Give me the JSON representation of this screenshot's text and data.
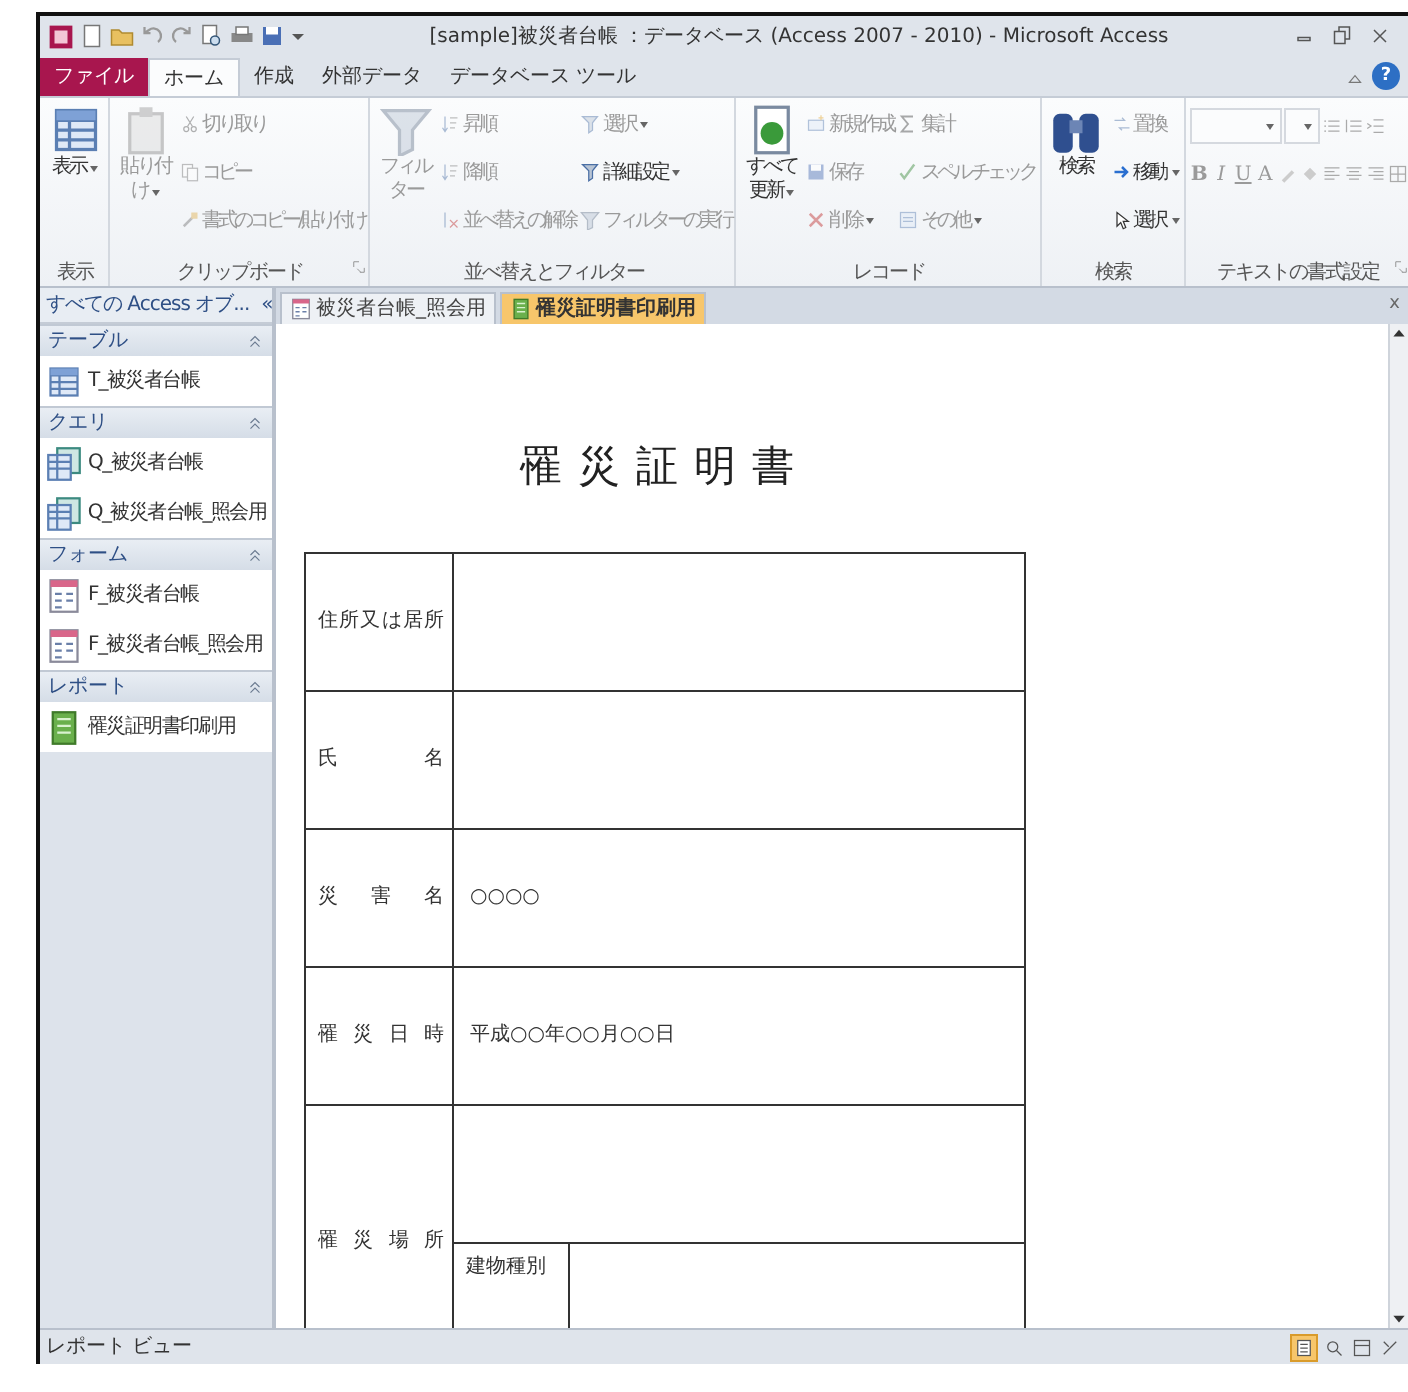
{
  "window": {
    "title": "[sample]被災者台帳 ：データベース (Access 2007 - 2010) - Microsoft Access"
  },
  "ribbon_tabs": [
    {
      "label": "ファイル",
      "kind": "file",
      "selected": false
    },
    {
      "label": "ホーム",
      "kind": "tab",
      "selected": true
    },
    {
      "label": "作成",
      "kind": "tab",
      "selected": false
    },
    {
      "label": "外部データ",
      "kind": "tab",
      "selected": false
    },
    {
      "label": "データベース ツール",
      "kind": "tab",
      "selected": false
    }
  ],
  "help": "?",
  "ribbon_groups": [
    {
      "label": "表示",
      "kind": "buttons",
      "launcher": false,
      "large": {
        "label": "表示",
        "kind": "view",
        "dropdown": true,
        "disabled": false
      }
    },
    {
      "label": "クリップボード",
      "kind": "buttons",
      "launcher": true,
      "large": {
        "label": "貼り付け",
        "kind": "paste",
        "dropdown": true,
        "disabled": true
      },
      "small_columns": [
        [
          {
            "label": "切り取り",
            "kind": "cut",
            "dropdown": false,
            "disabled": true
          },
          {
            "label": "コピー",
            "kind": "copy",
            "dropdown": false,
            "disabled": true
          },
          {
            "label": "書式のコピー/貼り付け",
            "kind": "brush",
            "dropdown": false,
            "disabled": true
          }
        ]
      ]
    },
    {
      "label": "並べ替えとフィルター",
      "kind": "buttons",
      "launcher": false,
      "large": {
        "label": "フィルター",
        "kind": "filter",
        "dropdown": false,
        "disabled": true
      },
      "small_columns": [
        [
          {
            "label": "昇順",
            "kind": "asc",
            "dropdown": false,
            "disabled": true
          },
          {
            "label": "降順",
            "kind": "desc",
            "dropdown": false,
            "disabled": true
          },
          {
            "label": "並べ替えの解除",
            "kind": "clearsort",
            "dropdown": false,
            "disabled": true
          }
        ],
        [
          {
            "label": "選択",
            "kind": "select",
            "dropdown": true,
            "disabled": true
          },
          {
            "label": "詳細設定",
            "kind": "advanced",
            "dropdown": true,
            "disabled": false
          },
          {
            "label": "フィルターの実行",
            "kind": "toggle",
            "dropdown": false,
            "disabled": true
          }
        ]
      ]
    },
    {
      "label": "レコード",
      "kind": "buttons",
      "launcher": false,
      "large": {
        "label": "すべて更新",
        "kind": "refresh",
        "dropdown": true,
        "disabled": false
      },
      "small_columns": [
        [
          {
            "label": "新規作成",
            "kind": "new",
            "dropdown": false,
            "disabled": true
          },
          {
            "label": "保存",
            "kind": "save",
            "dropdown": false,
            "disabled": true
          },
          {
            "label": "削除",
            "kind": "delete",
            "dropdown": true,
            "disabled": true
          }
        ],
        [
          {
            "label": "集計",
            "kind": "sum",
            "dropdown": false,
            "disabled": true
          },
          {
            "label": "スペル チェック",
            "kind": "spell",
            "dropdown": false,
            "disabled": true
          },
          {
            "label": "その他",
            "kind": "more",
            "dropdown": true,
            "disabled": true
          }
        ]
      ]
    },
    {
      "label": "検索",
      "kind": "buttons",
      "launcher": false,
      "large": {
        "label": "検索",
        "kind": "find",
        "dropdown": false,
        "disabled": false
      },
      "small_columns": [
        [
          {
            "label": "置換",
            "kind": "replace",
            "dropdown": false,
            "disabled": true
          },
          {
            "label": "移動",
            "kind": "goto",
            "dropdown": true,
            "disabled": false
          },
          {
            "label": "選択",
            "kind": "pointer",
            "dropdown": true,
            "disabled": false
          }
        ]
      ]
    },
    {
      "label": "テキストの書式設定",
      "kind": "text_format",
      "launcher": true,
      "letters": [
        "B",
        "I",
        "U",
        "A"
      ]
    }
  ],
  "nav": {
    "header": "すべての Access オブ...",
    "collapse": "«",
    "sections": [
      {
        "label": "テーブル",
        "expanded": true,
        "items": [
          {
            "label": "T_被災者台帳",
            "kind": "table"
          }
        ]
      },
      {
        "label": "クエリ",
        "expanded": true,
        "items": [
          {
            "label": "Q_被災者台帳",
            "kind": "query"
          },
          {
            "label": "Q_被災者台帳_照会用",
            "kind": "query"
          }
        ]
      },
      {
        "label": "フォーム",
        "expanded": true,
        "items": [
          {
            "label": "F_被災者台帳",
            "kind": "form"
          },
          {
            "label": "F_被災者台帳_照会用",
            "kind": "form"
          }
        ]
      },
      {
        "label": "レポート",
        "expanded": true,
        "items": [
          {
            "label": "罹災証明書印刷用",
            "kind": "report"
          }
        ]
      }
    ]
  },
  "doc_tabs": [
    {
      "label": "被災者台帳_照会用",
      "kind": "form",
      "selected": false
    },
    {
      "label": "罹災証明書印刷用",
      "kind": "report",
      "selected": true
    }
  ],
  "doc_close": "x",
  "report": {
    "title": "罹災証明書",
    "rows": [
      {
        "label": "住所又は居所"
      },
      {
        "label": "氏名"
      },
      {
        "label": "災害名",
        "value": "○○○○"
      },
      {
        "label": "罹災日時",
        "value": "平成○○年○○月○○日"
      },
      {
        "label": "罹災場所",
        "sub": [
          {
            "label": "建物種別"
          }
        ]
      }
    ]
  },
  "status_bar": {
    "text": "レポート ビュー"
  }
}
